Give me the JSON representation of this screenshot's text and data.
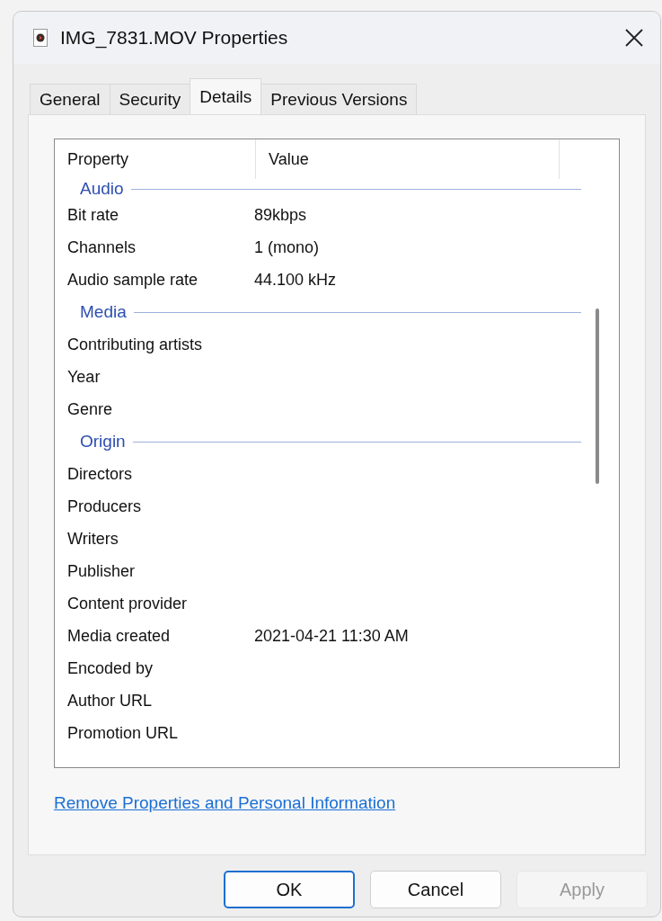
{
  "window": {
    "title": "IMG_7831.MOV Properties"
  },
  "tabs": [
    {
      "label": "General",
      "selected": false
    },
    {
      "label": "Security",
      "selected": false
    },
    {
      "label": "Details",
      "selected": true
    },
    {
      "label": "Previous Versions",
      "selected": false
    }
  ],
  "table": {
    "columns": [
      "Property",
      "Value"
    ],
    "groups": [
      {
        "name": "Audio",
        "rows": [
          {
            "property": "Bit rate",
            "value": "89kbps"
          },
          {
            "property": "Channels",
            "value": "1 (mono)"
          },
          {
            "property": "Audio sample rate",
            "value": "44.100 kHz"
          }
        ]
      },
      {
        "name": "Media",
        "rows": [
          {
            "property": "Contributing artists"
          },
          {
            "property": "Year"
          },
          {
            "property": "Genre"
          }
        ]
      },
      {
        "name": "Origin",
        "rows": [
          {
            "property": "Directors"
          },
          {
            "property": "Producers"
          },
          {
            "property": "Writers"
          },
          {
            "property": "Publisher"
          },
          {
            "property": "Content provider"
          },
          {
            "property": "Media created",
            "value": "2021-04-21 11:30 AM"
          },
          {
            "property": "Encoded by"
          },
          {
            "property": "Author URL"
          },
          {
            "property": "Promotion URL"
          }
        ]
      }
    ]
  },
  "link": "Remove Properties and Personal Information",
  "buttons": [
    {
      "label": "OK",
      "kind": "default",
      "disabled": false
    },
    {
      "label": "Cancel",
      "kind": "normal",
      "disabled": false
    },
    {
      "label": "Apply",
      "kind": "normal",
      "disabled": true
    }
  ]
}
